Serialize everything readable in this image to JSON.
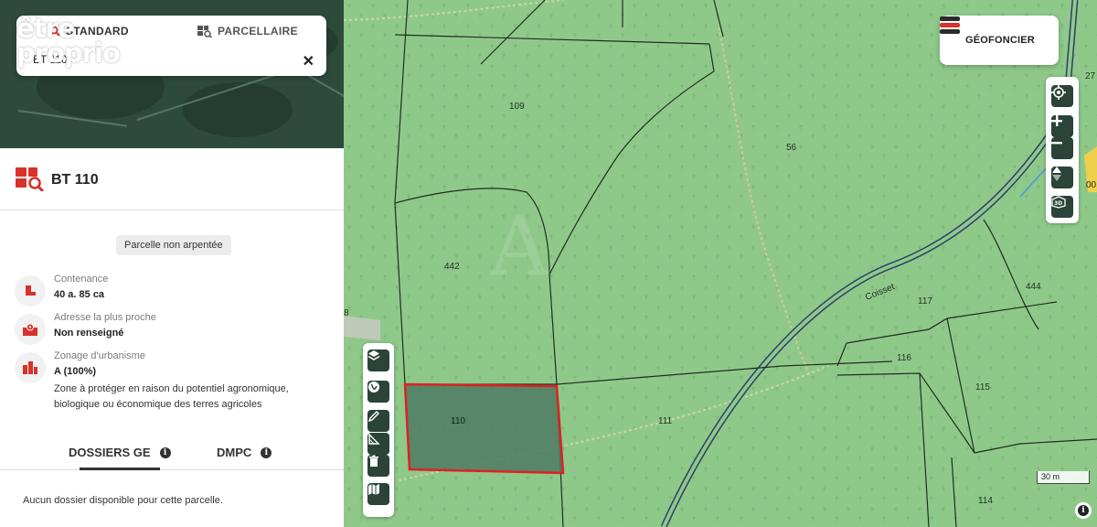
{
  "watermark": {
    "line1": "être",
    "line2": "proprio"
  },
  "search": {
    "tab_standard": "STANDARD",
    "tab_parcel": "PARCELLAIRE",
    "value": "BT 110",
    "clear": "✕"
  },
  "parcel": {
    "title": "BT 110",
    "badge": "Parcelle non arpentée",
    "info": [
      {
        "label": "Contenance",
        "value": "40 a. 85 ca"
      },
      {
        "label": "Adresse la plus proche",
        "value": "Non renseigné"
      },
      {
        "label": "Zonage d'urbanisme",
        "value": "A (100%)",
        "description": "Zone à protéger en raison du potentiel agronomique, biologique ou économique des terres agricoles"
      }
    ]
  },
  "tabs": [
    {
      "label": "DOSSIERS GE",
      "active": true
    },
    {
      "label": "DMPC",
      "active": false
    }
  ],
  "empty_message": "Aucun dossier disponible pour cette parcelle.",
  "brand": {
    "name": "GÉOFONCIER",
    "accent": "#d7322b",
    "dark": "#2b2b2b"
  },
  "map": {
    "parcel_numbers": [
      "109",
      "56",
      "442",
      "110",
      "111",
      "117",
      "116",
      "115",
      "444",
      "114",
      "8",
      "27",
      "00"
    ],
    "road_label": "Coisset",
    "scale_label": "30 m",
    "selected_parcel": "110",
    "colors": {
      "terrain": "#8fc98a",
      "selection_fill": "#4d7a63",
      "selection_stroke": "#e02020",
      "control": "#2b4338"
    }
  },
  "icons": {
    "tools": [
      "layers-icon",
      "globe-icon",
      "pencil-icon",
      "measure-icon",
      "trash-icon",
      "map-icon"
    ],
    "controls": [
      "locate-icon",
      "zoom-in-icon",
      "zoom-out-icon",
      "compass-icon",
      "3d-icon"
    ]
  }
}
